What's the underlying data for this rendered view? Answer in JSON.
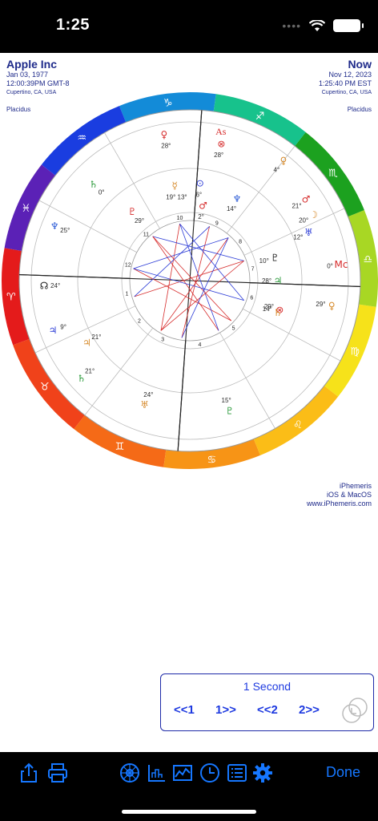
{
  "status": {
    "time": "1:25"
  },
  "chart_left": {
    "title": "Apple Inc",
    "date": "Jan 03, 1977",
    "time": "12:00:39PM GMT-8",
    "place": "Cupertino, CA, USA",
    "system": "Placidus"
  },
  "chart_right": {
    "title": "Now",
    "date": "Nov 12, 2023",
    "time": "1:25:40 PM EST",
    "place": "Cupertino, CA, USA",
    "system": "Placidus"
  },
  "wheel": {
    "colors": {
      "aries": "#e41b1b",
      "taurus": "#f0421a",
      "gemini": "#f56a17",
      "cancer": "#f79416",
      "leo": "#fbbd17",
      "virgo": "#f6e21a",
      "libra": "#a8d724",
      "scorpio": "#1ca11f",
      "sagittarius": "#17c28c",
      "capricorn": "#138bd8",
      "aquarius": "#1a3de0",
      "pisces": "#5b21b6",
      "pisces2": "#b11a88"
    },
    "planet_labels": [
      {
        "text": "28°",
        "color": "#2b2b2b"
      },
      {
        "text": "0°",
        "color": "#2b2b2b"
      },
      {
        "text": "25°",
        "color": "#2b2b2b"
      },
      {
        "text": "24°",
        "color": "#2b2b2b"
      },
      {
        "text": "9°",
        "color": "#2b2b2b"
      },
      {
        "text": "21°",
        "color": "#2b2b2b"
      },
      {
        "text": "21°",
        "color": "#2b2b2b"
      },
      {
        "text": "24°",
        "color": "#2b2b2b"
      },
      {
        "text": "15°",
        "color": "#2b2b2b"
      },
      {
        "text": "29°",
        "color": "#2b2b2b"
      },
      {
        "text": "28°",
        "color": "#2b2b2b"
      },
      {
        "text": "6°",
        "color": "#2b2b2b"
      },
      {
        "text": "14°",
        "color": "#2b2b2b"
      },
      {
        "text": "21°",
        "color": "#2b2b2b"
      },
      {
        "text": "20°",
        "color": "#2b2b2b"
      },
      {
        "text": "12°",
        "color": "#2b2b2b"
      },
      {
        "text": "10°",
        "color": "#2b2b2b"
      },
      {
        "text": "0°",
        "color": "#2b2b2b"
      },
      {
        "text": "28°",
        "color": "#2b2b2b"
      },
      {
        "text": "14°",
        "color": "#2b2b2b"
      },
      {
        "text": "29°",
        "color": "#2b2b2b"
      },
      {
        "text": "4°",
        "color": "#2b2b2b"
      },
      {
        "text": "19° 13°",
        "color": "#2b2b2b"
      },
      {
        "text": "2°",
        "color": "#2b2b2b"
      },
      {
        "text": "29°",
        "color": "#2b2b2b"
      }
    ],
    "asc_label": "As",
    "mc_label": "Mc"
  },
  "credit": {
    "line1": "iPhemeris",
    "line2": "iOS & MacOS",
    "line3": "www.iPhemeris.com"
  },
  "timer": {
    "label": "1 Second",
    "btn_back1": "<<1",
    "btn_fwd1": "1>>",
    "btn_back2": "<<2",
    "btn_fwd2": "2>>"
  },
  "toolbar": {
    "done": "Done"
  }
}
